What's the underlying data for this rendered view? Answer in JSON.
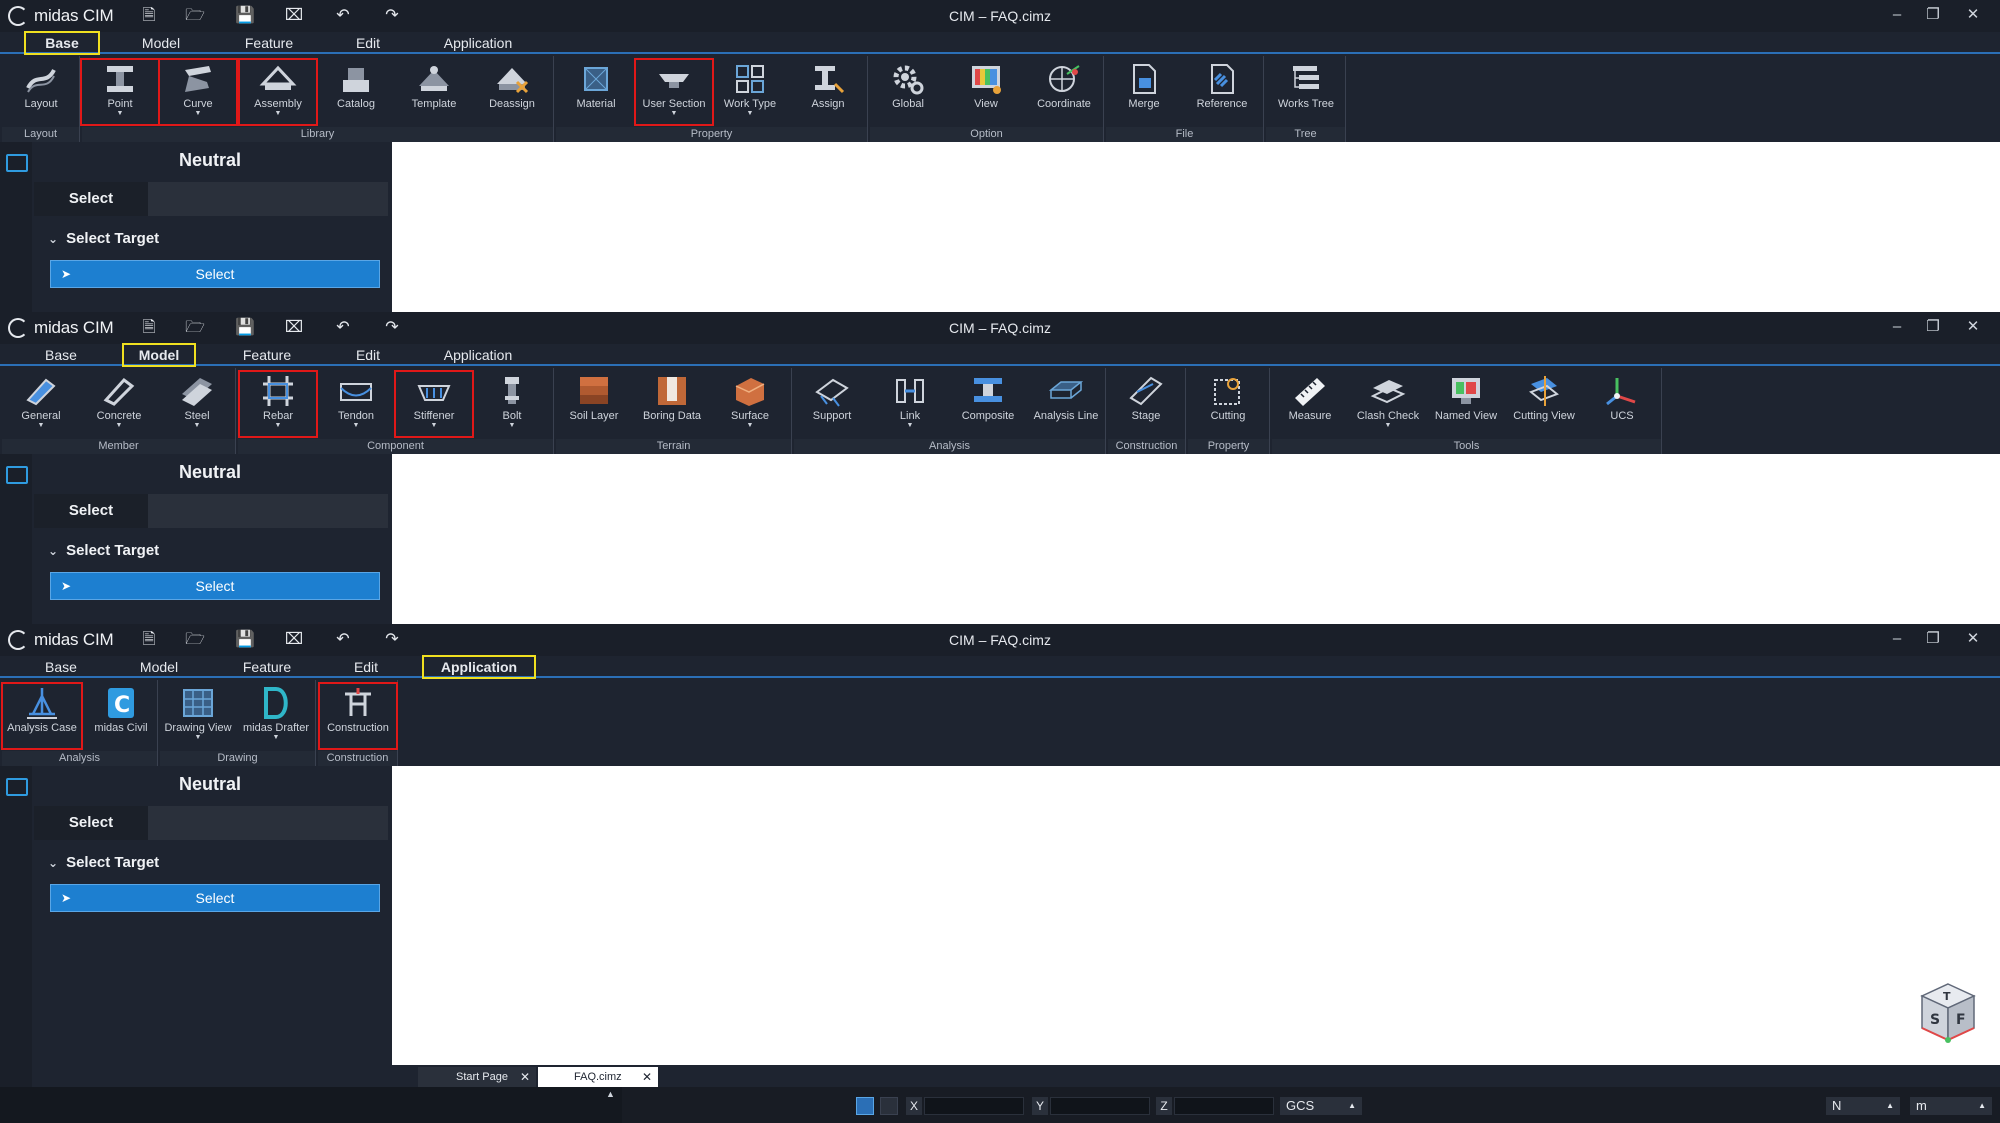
{
  "app": {
    "brand": "midas CIM",
    "window_title": "CIM – FAQ.cimz"
  },
  "menu": [
    "Base",
    "Model",
    "Feature",
    "Edit",
    "Application"
  ],
  "screens": [
    {
      "active_tab": "Base",
      "groups": [
        {
          "label": "Layout",
          "buttons": [
            {
              "label": "Layout",
              "icon": "layout-icon",
              "dropdown": false,
              "highlight": false
            }
          ]
        },
        {
          "label": "Library",
          "buttons": [
            {
              "label": "Point",
              "icon": "point-icon",
              "dropdown": true,
              "highlight": true
            },
            {
              "label": "Curve",
              "icon": "curve-icon",
              "dropdown": true,
              "highlight": true
            },
            {
              "label": "Assembly",
              "icon": "assembly-icon",
              "dropdown": true,
              "highlight": true
            },
            {
              "label": "Catalog",
              "icon": "catalog-icon",
              "dropdown": false,
              "highlight": false
            },
            {
              "label": "Template",
              "icon": "template-icon",
              "dropdown": false,
              "highlight": false
            },
            {
              "label": "Deassign",
              "icon": "deassign-icon",
              "dropdown": false,
              "highlight": false
            }
          ]
        },
        {
          "label": "Property",
          "buttons": [
            {
              "label": "Material",
              "icon": "material-icon",
              "dropdown": false,
              "highlight": false
            },
            {
              "label": "User Section",
              "icon": "user-section-icon",
              "dropdown": true,
              "highlight": true
            },
            {
              "label": "Work Type",
              "icon": "work-type-icon",
              "dropdown": true,
              "highlight": false
            },
            {
              "label": "Assign",
              "icon": "assign-icon",
              "dropdown": false,
              "highlight": false
            }
          ]
        },
        {
          "label": "Option",
          "buttons": [
            {
              "label": "Global",
              "icon": "gear-icon",
              "dropdown": false,
              "highlight": false
            },
            {
              "label": "View",
              "icon": "view-icon",
              "dropdown": false,
              "highlight": false
            },
            {
              "label": "Coordinate",
              "icon": "coordinate-icon",
              "dropdown": false,
              "highlight": false
            }
          ]
        },
        {
          "label": "File",
          "buttons": [
            {
              "label": "Merge",
              "icon": "merge-icon",
              "dropdown": false,
              "highlight": false
            },
            {
              "label": "Reference",
              "icon": "reference-icon",
              "dropdown": false,
              "highlight": false
            }
          ]
        },
        {
          "label": "Tree",
          "buttons": [
            {
              "label": "Works Tree",
              "icon": "works-tree-icon",
              "dropdown": false,
              "highlight": false
            }
          ]
        }
      ]
    },
    {
      "active_tab": "Model",
      "groups": [
        {
          "label": "Member",
          "buttons": [
            {
              "label": "General",
              "icon": "general-icon",
              "dropdown": true,
              "highlight": false
            },
            {
              "label": "Concrete",
              "icon": "concrete-icon",
              "dropdown": true,
              "highlight": false
            },
            {
              "label": "Steel",
              "icon": "steel-icon",
              "dropdown": true,
              "highlight": false
            }
          ]
        },
        {
          "label": "Component",
          "buttons": [
            {
              "label": "Rebar",
              "icon": "rebar-icon",
              "dropdown": true,
              "highlight": true
            },
            {
              "label": "Tendon",
              "icon": "tendon-icon",
              "dropdown": true,
              "highlight": false
            },
            {
              "label": "Stiffener",
              "icon": "stiffener-icon",
              "dropdown": true,
              "highlight": true
            },
            {
              "label": "Bolt",
              "icon": "bolt-icon",
              "dropdown": true,
              "highlight": false
            }
          ]
        },
        {
          "label": "Terrain",
          "buttons": [
            {
              "label": "Soil Layer",
              "icon": "soil-layer-icon",
              "dropdown": false,
              "highlight": false
            },
            {
              "label": "Boring Data",
              "icon": "boring-data-icon",
              "dropdown": false,
              "highlight": false
            },
            {
              "label": "Surface",
              "icon": "surface-icon",
              "dropdown": true,
              "highlight": false
            }
          ]
        },
        {
          "label": "Analysis",
          "buttons": [
            {
              "label": "Support",
              "icon": "support-icon",
              "dropdown": false,
              "highlight": false
            },
            {
              "label": "Link",
              "icon": "link-icon",
              "dropdown": true,
              "highlight": false
            },
            {
              "label": "Composite",
              "icon": "composite-icon",
              "dropdown": false,
              "highlight": false
            },
            {
              "label": "Analysis Line",
              "icon": "analysis-line-icon",
              "dropdown": false,
              "highlight": false
            }
          ]
        },
        {
          "label": "Construction",
          "buttons": [
            {
              "label": "Stage",
              "icon": "stage-icon",
              "dropdown": false,
              "highlight": false
            }
          ]
        },
        {
          "label": "Property",
          "buttons": [
            {
              "label": "Cutting",
              "icon": "cutting-icon",
              "dropdown": false,
              "highlight": false
            }
          ]
        },
        {
          "label": "Tools",
          "buttons": [
            {
              "label": "Measure",
              "icon": "measure-icon",
              "dropdown": false,
              "highlight": false
            },
            {
              "label": "Clash Check",
              "icon": "clash-check-icon",
              "dropdown": true,
              "highlight": false
            },
            {
              "label": "Named View",
              "icon": "named-view-icon",
              "dropdown": false,
              "highlight": false
            },
            {
              "label": "Cutting View",
              "icon": "cutting-view-icon",
              "dropdown": false,
              "highlight": false
            },
            {
              "label": "UCS",
              "icon": "ucs-icon",
              "dropdown": false,
              "highlight": false
            }
          ]
        }
      ]
    },
    {
      "active_tab": "Application",
      "groups": [
        {
          "label": "Analysis",
          "buttons": [
            {
              "label": "Analysis Case",
              "icon": "analysis-case-icon",
              "dropdown": false,
              "highlight": true
            },
            {
              "label": "midas Civil",
              "icon": "midas-civil-icon",
              "dropdown": false,
              "highlight": false
            }
          ]
        },
        {
          "label": "Drawing",
          "buttons": [
            {
              "label": "Drawing View",
              "icon": "drawing-view-icon",
              "dropdown": true,
              "highlight": false
            },
            {
              "label": "midas Drafter",
              "icon": "midas-drafter-icon",
              "dropdown": true,
              "highlight": false
            }
          ]
        },
        {
          "label": "Construction",
          "buttons": [
            {
              "label": "Construction",
              "icon": "construction-icon",
              "dropdown": false,
              "highlight": true
            }
          ]
        }
      ]
    }
  ],
  "panel": {
    "title": "Neutral",
    "tab": "Select",
    "section": "Select Target",
    "button": "Select"
  },
  "doc_tabs": [
    "Start Page",
    "FAQ.cimz"
  ],
  "status": {
    "x_label": "X",
    "y_label": "Y",
    "z_label": "Z",
    "coord_system": "GCS",
    "force_unit": "N",
    "length_unit": "m"
  },
  "nav_cube": {
    "top": "T",
    "left": "S",
    "right": "F"
  },
  "colors": {
    "accent": "#1d7fd0",
    "highlight_red": "#e01818",
    "highlight_yellow": "#f0e020"
  }
}
